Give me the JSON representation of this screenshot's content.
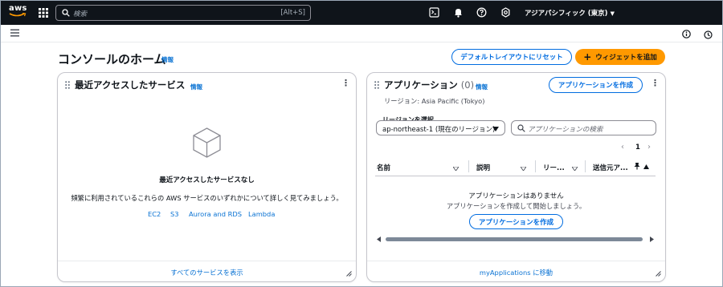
{
  "topnav": {
    "logo_text": "aws",
    "search_placeholder": "検索",
    "search_shortcut": "[Alt+S]",
    "icons": [
      "services-grid-icon",
      "cloudshell-icon",
      "bell-icon",
      "help-icon",
      "gear-icon"
    ],
    "region_label": "アジアパシフィック (東京)"
  },
  "page": {
    "title": "コンソールのホーム",
    "info_label": "情報",
    "reset_button": "デフォルトレイアウトにリセット",
    "add_widget_button": "ウィジェットを追加"
  },
  "recent": {
    "title": "最近アクセスしたサービス",
    "info_label": "情報",
    "empty_title": "最近アクセスしたサービスなし",
    "empty_desc": "頻繁に利用されているこれらの AWS サービスのいずれかについて詳しく見てみましょう。",
    "service_links": [
      "EC2",
      "S3",
      "Aurora and RDS",
      "Lambda"
    ],
    "footer_link": "すべてのサービスを表示"
  },
  "apps": {
    "title": "アプリケーション",
    "count": "(0)",
    "info_label": "情報",
    "create_button": "アプリケーションを作成",
    "region_text": "リージョン: Asia Pacific (Tokyo)",
    "region_select_label": "リージョンを選択",
    "region_select_value": "ap-northeast-1 (現在のリージョン)",
    "search_placeholder": "アプリケーションの検索",
    "page_number": "1",
    "columns": [
      "名前",
      "説明",
      "リー...",
      "送信元ア..."
    ],
    "empty_title": "アプリケーションはありません",
    "empty_desc": "アプリケーションを作成して開始しましょう。",
    "empty_create_button": "アプリケーションを作成",
    "footer_link": "myApplications に移動"
  },
  "colors": {
    "nav_bg": "#0f141a",
    "link": "#0972d3",
    "primary": "#ff9900",
    "outline": "#006ce0"
  }
}
